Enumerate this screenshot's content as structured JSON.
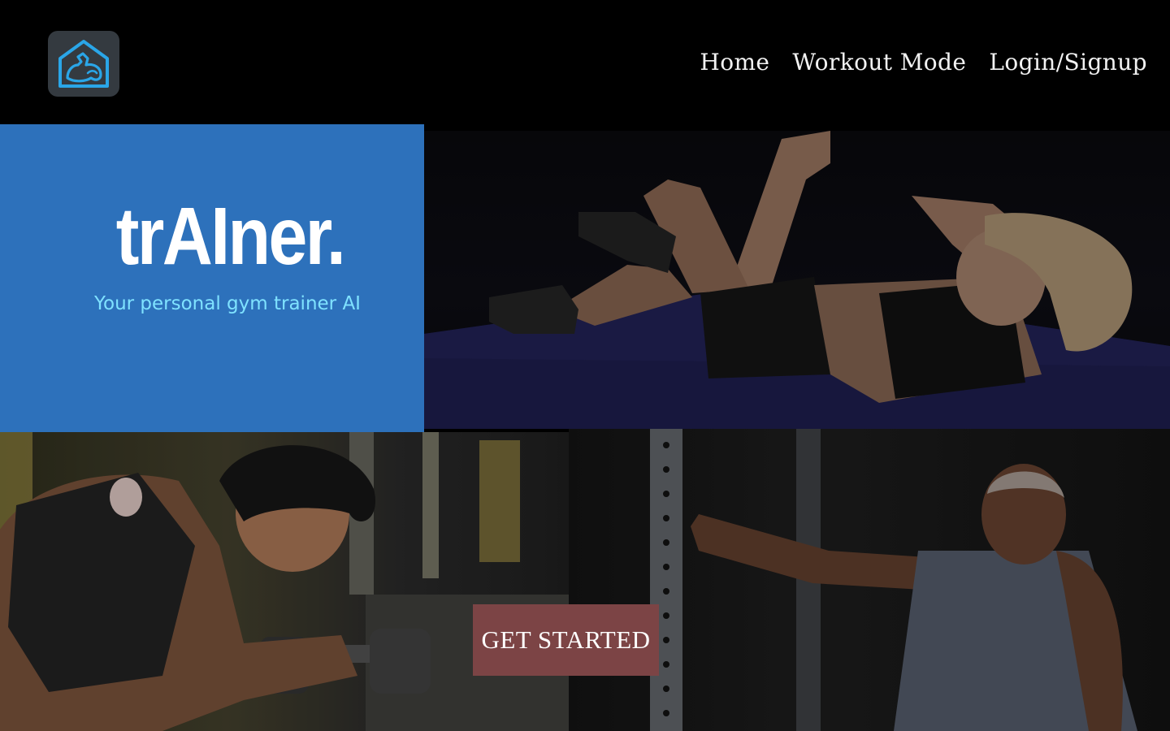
{
  "header": {
    "logo_icon": "flexed-arm-house-icon",
    "nav": [
      {
        "label": "Home"
      },
      {
        "label": "Workout Mode"
      },
      {
        "label": "Login/Signup"
      }
    ]
  },
  "hero": {
    "title": "trAIner.",
    "tagline": "Your personal gym trainer AI",
    "panel_color": "#2d71bb",
    "tagline_color": "#7fe2ff"
  },
  "cta": {
    "label": "GET STARTED",
    "color": "#7c4445"
  },
  "photos": [
    {
      "subject": "woman-doing-crunches-on-mat"
    },
    {
      "subject": "man-lifting-dumbbell"
    },
    {
      "subject": "man-stretching-arm-on-rack"
    }
  ]
}
